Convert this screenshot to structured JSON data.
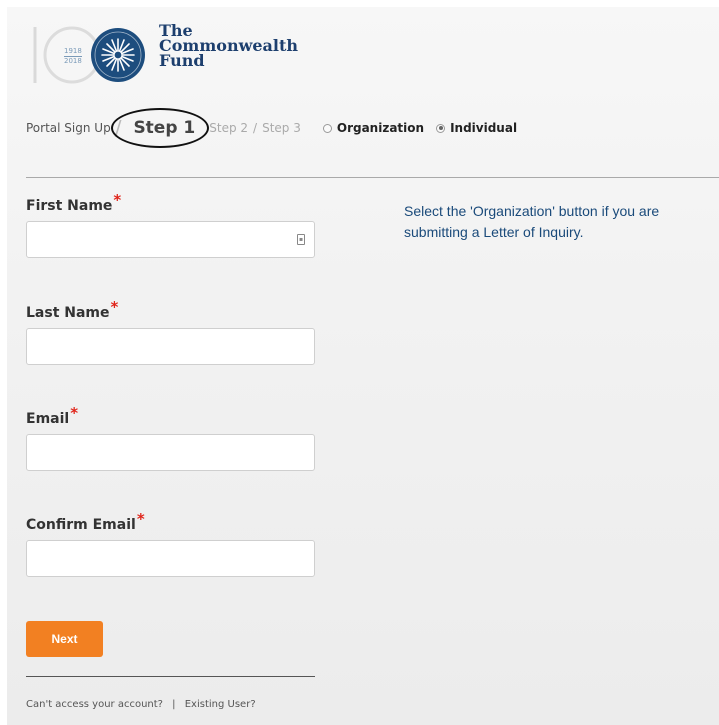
{
  "logo": {
    "years": [
      "1918",
      "2018"
    ],
    "lines": [
      "The",
      "Commonwealth",
      "Fund"
    ],
    "brand_color": "#1d3f6e"
  },
  "steps": {
    "breadcrumb": "Portal Sign Up",
    "current": "Step 1",
    "step2": "Step 2",
    "step3": "Step 3",
    "separator": "/"
  },
  "account_type": {
    "options": [
      {
        "label": "Organization",
        "checked": false
      },
      {
        "label": "Individual",
        "checked": true
      }
    ]
  },
  "form": {
    "first_name_label": "First Name",
    "last_name_label": "Last Name",
    "email_label": "Email",
    "confirm_email_label": "Confirm Email",
    "required_mark": "*"
  },
  "help_text": "Select the 'Organization' button if you are submitting a Letter of Inquiry.",
  "next_button": "Next",
  "footer": {
    "cant_access": "Can't access your account?",
    "separator": "|",
    "existing_user": "Existing User?"
  },
  "colors": {
    "accent": "#f28022",
    "required": "#e0251b",
    "help_text": "#1a4a7a"
  }
}
